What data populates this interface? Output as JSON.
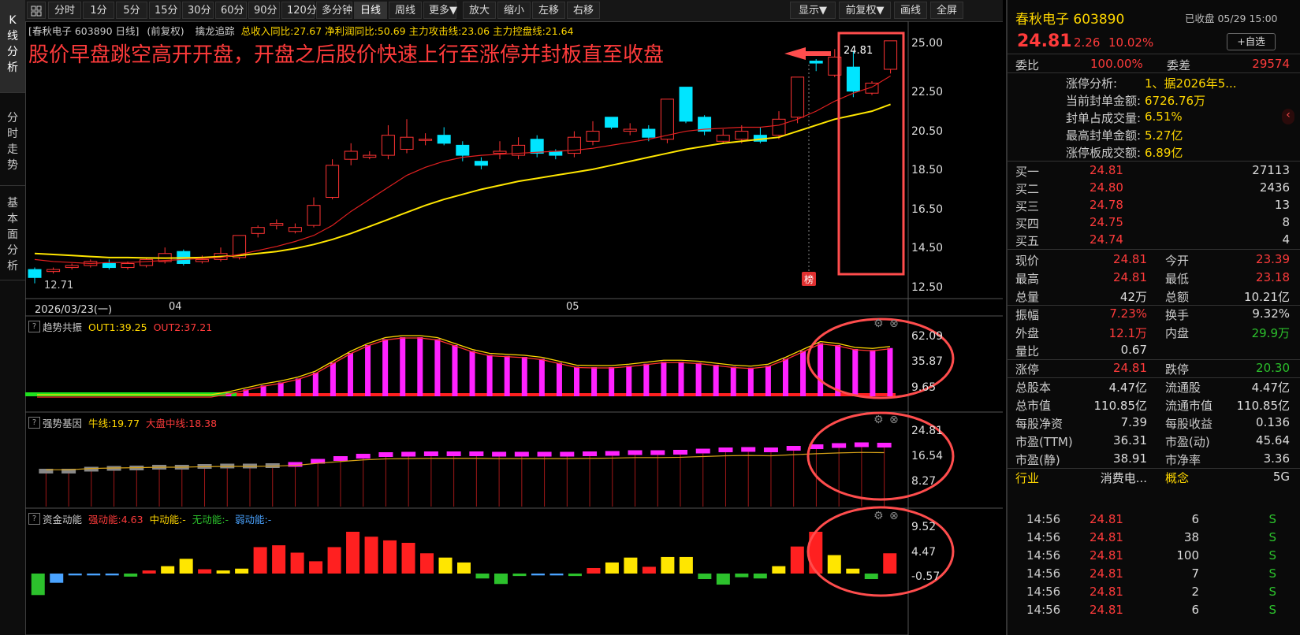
{
  "left_tabs": [
    "K线分析",
    "分时走势",
    "基本面分析"
  ],
  "toolbar": {
    "periods": [
      "分时",
      "1分",
      "5分",
      "15分",
      "30分",
      "60分",
      "90分",
      "120分",
      "多分钟",
      "日线",
      "周线",
      "更多▼"
    ],
    "tools": [
      "放大",
      "缩小",
      "左移",
      "右移"
    ],
    "right": [
      "显示▼",
      "前复权▼",
      "画线",
      "全屏"
    ],
    "active": "日线"
  },
  "chart": {
    "header": "[春秋电子 603890 日线]",
    "adjust": "(前复权)",
    "feature": "擒龙追踪",
    "metrics": "总收入同比:27.67 净利润同比:50.69 主力攻击线:23.06 主力控盘线:21.64",
    "annotation": "股价早盘跳空高开开盘，开盘之后股价快速上行至涨停并封板直至收盘",
    "price_axis": [
      "25.00",
      "22.50",
      "20.50",
      "18.50",
      "16.50",
      "14.50",
      "12.50"
    ],
    "date_labels": [
      "2026/03/23(一)",
      "04",
      "05"
    ],
    "low_label": "12.71",
    "high_label": "24.81",
    "bang_label": "榜",
    "up_color": "#ff3333",
    "down_color": "#00e5ff",
    "ma_short_color": "#e02020",
    "ma_long_color": "#ffe600"
  },
  "panels": [
    {
      "name": "趋势共振",
      "series": [
        {
          "name": "OUT1",
          "value": "39.25"
        },
        {
          "name": "OUT2",
          "value": "37.21"
        }
      ],
      "axis": [
        "62.09",
        "35.87",
        "9.65"
      ]
    },
    {
      "name": "强势基因",
      "series": [
        {
          "name": "牛线",
          "value": "19.77"
        },
        {
          "name": "大盘中线",
          "value": "18.38"
        }
      ],
      "axis": [
        "24.81",
        "16.54",
        "8.27"
      ]
    },
    {
      "name": "资金动能",
      "series": [
        {
          "name": "强动能",
          "value": "4.63"
        },
        {
          "name": "中动能",
          "value": "-"
        },
        {
          "name": "无动能",
          "value": "-"
        },
        {
          "name": "弱动能",
          "value": "-"
        }
      ],
      "axis": [
        "9.52",
        "4.47",
        "-0.57"
      ]
    }
  ],
  "candles": [
    [
      13.4,
      13.0,
      13.5,
      12.71
    ],
    [
      13.3,
      13.4,
      13.5,
      13.2
    ],
    [
      13.5,
      13.6,
      13.7,
      13.4
    ],
    [
      13.6,
      13.8,
      13.9,
      13.5
    ],
    [
      13.7,
      13.5,
      13.9,
      13.4
    ],
    [
      13.5,
      13.7,
      13.8,
      13.4
    ],
    [
      13.6,
      13.9,
      14.0,
      13.5
    ],
    [
      13.8,
      14.2,
      14.5,
      13.7
    ],
    [
      14.3,
      13.7,
      14.4,
      13.6
    ],
    [
      13.8,
      13.9,
      14.1,
      13.7
    ],
    [
      13.9,
      14.2,
      14.5,
      13.8
    ],
    [
      14.0,
      15.1,
      15.1,
      13.9
    ],
    [
      15.2,
      15.5,
      15.6,
      15.0
    ],
    [
      15.6,
      15.7,
      15.9,
      15.4
    ],
    [
      15.3,
      15.5,
      15.7,
      15.2
    ],
    [
      15.6,
      16.6,
      17.0,
      15.5
    ],
    [
      17.0,
      18.6,
      18.9,
      16.9
    ],
    [
      18.9,
      19.3,
      19.7,
      18.6
    ],
    [
      19.0,
      19.1,
      19.3,
      18.9
    ],
    [
      19.1,
      20.1,
      20.6,
      18.9
    ],
    [
      19.4,
      20.0,
      20.9,
      19.2
    ],
    [
      19.9,
      19.9,
      20.2,
      19.6
    ],
    [
      20.1,
      19.7,
      20.5,
      19.6
    ],
    [
      19.6,
      19.1,
      19.8,
      18.8
    ],
    [
      18.8,
      18.6,
      19.0,
      18.4
    ],
    [
      19.2,
      19.3,
      19.8,
      18.9
    ],
    [
      19.1,
      19.6,
      20.0,
      18.9
    ],
    [
      19.9,
      19.2,
      20.1,
      19.0
    ],
    [
      19.3,
      19.1,
      19.4,
      18.9
    ],
    [
      19.2,
      20.0,
      20.3,
      19.0
    ],
    [
      19.8,
      20.3,
      20.8,
      19.6
    ],
    [
      21.0,
      20.5,
      21.0,
      20.4
    ],
    [
      20.3,
      20.4,
      20.7,
      20.1
    ],
    [
      20.4,
      20.0,
      20.6,
      19.8
    ],
    [
      19.9,
      21.9,
      21.9,
      19.7
    ],
    [
      22.5,
      20.8,
      22.5,
      20.7
    ],
    [
      21.0,
      20.3,
      21.1,
      20.1
    ],
    [
      19.8,
      20.1,
      20.4,
      19.7
    ],
    [
      19.9,
      20.3,
      20.6,
      19.7
    ],
    [
      20.1,
      19.8,
      20.5,
      19.7
    ],
    [
      20.1,
      20.9,
      21.3,
      19.9
    ],
    [
      21.0,
      23.0,
      23.0,
      20.7
    ],
    [
      23.8,
      23.7,
      23.9,
      23.3
    ],
    [
      23.1,
      24.0,
      24.4,
      23.0
    ],
    [
      23.5,
      22.3,
      24.3,
      22.0
    ],
    [
      22.2,
      22.7,
      22.8,
      22.1
    ],
    [
      23.39,
      24.81,
      24.81,
      23.18
    ]
  ],
  "ma_short": [
    13.9,
    13.8,
    13.75,
    13.7,
    13.75,
    13.75,
    13.8,
    13.85,
    13.9,
    13.95,
    14.0,
    14.15,
    14.35,
    14.55,
    14.8,
    15.1,
    15.6,
    16.3,
    16.9,
    17.5,
    18.1,
    18.5,
    18.8,
    19.0,
    19.1,
    19.15,
    19.2,
    19.25,
    19.3,
    19.35,
    19.45,
    19.6,
    19.75,
    19.9,
    20.1,
    20.3,
    20.4,
    20.45,
    20.5,
    20.5,
    20.6,
    20.9,
    21.3,
    21.8,
    22.2,
    22.5,
    23.06
  ],
  "ma_long": [
    14.2,
    14.15,
    14.1,
    14.05,
    14.0,
    14.0,
    13.98,
    13.97,
    13.98,
    14.0,
    14.05,
    14.1,
    14.2,
    14.3,
    14.45,
    14.65,
    14.9,
    15.2,
    15.55,
    15.9,
    16.25,
    16.6,
    16.9,
    17.15,
    17.4,
    17.6,
    17.8,
    17.95,
    18.1,
    18.25,
    18.4,
    18.6,
    18.8,
    19.0,
    19.2,
    19.4,
    19.55,
    19.7,
    19.8,
    19.9,
    20.0,
    20.3,
    20.6,
    20.9,
    21.1,
    21.3,
    21.64
  ],
  "trend_bars": [
    0,
    0,
    0,
    0,
    0,
    0,
    0,
    0,
    0,
    0,
    0,
    1.5,
    3.5,
    5.5,
    7,
    9,
    12,
    17,
    22,
    26,
    29,
    30,
    30,
    29,
    26,
    23,
    21,
    20.5,
    20,
    19,
    17,
    15,
    14.8,
    14.8,
    15.5,
    16.5,
    17.5,
    17.5,
    17,
    16,
    15,
    14.5,
    15.5,
    19,
    23,
    27,
    26,
    24,
    23.5,
    24.5
  ],
  "gene_bars": [
    -1,
    -1,
    -0.5,
    -0.3,
    -0.2,
    0,
    0,
    0.2,
    0.3,
    0.3,
    0.4,
    0.7,
    1.5,
    2.2,
    2.8,
    3.2,
    3.3,
    3.4,
    3.4,
    3.4,
    3.3,
    3.3,
    3.3,
    3.3,
    3.4,
    3.5,
    3.7,
    3.7,
    3.8,
    4.1,
    4.4,
    4.5,
    4.4,
    4.8,
    5.2,
    5.5,
    5.7,
    5.6
  ],
  "fund_bars": [
    -3.5,
    -1.5,
    -0.3,
    -0.3,
    -0.3,
    -0.5,
    0.5,
    1.2,
    2.4,
    0.7,
    0.5,
    0.8,
    4.3,
    4.6,
    3.4,
    2.0,
    4.3,
    6.8,
    6.0,
    5.4,
    5.0,
    3.3,
    2.6,
    1.8,
    -0.8,
    -1.7,
    -0.4,
    -0.3,
    -0.3,
    -0.4,
    0.9,
    1.8,
    2.6,
    1.1,
    2.7,
    2.7,
    -0.9,
    -1.8,
    -0.6,
    -0.8,
    1.2,
    4.4,
    6.8,
    3.0,
    0.8,
    -0.9,
    3.3
  ],
  "quote": {
    "name": "春秋电子 603890",
    "status": "已收盘 05/29 15:00",
    "price": "24.81",
    "change": "2.26",
    "change_pct": "10.02%",
    "add_btn": "+自选",
    "weibi_label": "委比",
    "weibi": "100.00%",
    "weicha_label": "委差",
    "weicha": "29574",
    "zt_lines": [
      {
        "label": "涨停分析:",
        "value": "1、据2026年5..."
      },
      {
        "label": "当前封单金额:",
        "value": "6726.76万"
      },
      {
        "label": "封单占成交量:",
        "value": "6.51%"
      },
      {
        "label": "最高封单金额:",
        "value": "5.27亿"
      },
      {
        "label": "涨停板成交额:",
        "value": "6.89亿"
      }
    ],
    "bids": [
      {
        "label": "买一",
        "price": "24.81",
        "vol": "27113"
      },
      {
        "label": "买二",
        "price": "24.80",
        "vol": "2436"
      },
      {
        "label": "买三",
        "price": "24.78",
        "vol": "13"
      },
      {
        "label": "买四",
        "price": "24.75",
        "vol": "8"
      },
      {
        "label": "买五",
        "price": "24.74",
        "vol": "4"
      }
    ],
    "stats": [
      {
        "l1": "现价",
        "v1": "24.81",
        "c1": "red",
        "l2": "今开",
        "v2": "23.39",
        "c2": "red"
      },
      {
        "l1": "最高",
        "v1": "24.81",
        "c1": "red",
        "l2": "最低",
        "v2": "23.18",
        "c2": "red"
      },
      {
        "l1": "总量",
        "v1": "42万",
        "c1": "white",
        "l2": "总额",
        "v2": "10.21亿",
        "c2": "white"
      },
      {
        "l1": "振幅",
        "v1": "7.23%",
        "c1": "red",
        "l2": "换手",
        "v2": "9.32%",
        "c2": "white"
      },
      {
        "l1": "外盘",
        "v1": "12.1万",
        "c1": "red",
        "l2": "内盘",
        "v2": "29.9万",
        "c2": "green"
      },
      {
        "l1": "量比",
        "v1": "0.67",
        "c1": "white",
        "l2": "",
        "v2": "",
        "c2": "white"
      },
      {
        "l1": "涨停",
        "v1": "24.81",
        "c1": "red",
        "l2": "跌停",
        "v2": "20.30",
        "c2": "green"
      },
      {
        "l1": "总股本",
        "v1": "4.47亿",
        "c1": "white",
        "l2": "流通股",
        "v2": "4.47亿",
        "c2": "white"
      },
      {
        "l1": "总市值",
        "v1": "110.85亿",
        "c1": "white",
        "l2": "流通市值",
        "v2": "110.85亿",
        "c2": "white"
      },
      {
        "l1": "每股净资",
        "v1": "7.39",
        "c1": "white",
        "l2": "每股收益",
        "v2": "0.136",
        "c2": "white"
      },
      {
        "l1": "市盈(TTM)",
        "v1": "36.31",
        "c1": "white",
        "l2": "市盈(动)",
        "v2": "45.64",
        "c2": "white"
      },
      {
        "l1": "市盈(静)",
        "v1": "38.91",
        "c1": "white",
        "l2": "市净率",
        "v2": "3.36",
        "c2": "white"
      },
      {
        "l1": "行业",
        "v1": "消费电...",
        "c1": "white",
        "l2": "概念",
        "v2": "5G",
        "c2": "white"
      }
    ],
    "ticks": [
      {
        "time": "14:56",
        "price": "24.81",
        "vol": "6",
        "side": "S"
      },
      {
        "time": "14:56",
        "price": "24.81",
        "vol": "38",
        "side": "S"
      },
      {
        "time": "14:56",
        "price": "24.81",
        "vol": "100",
        "side": "S"
      },
      {
        "time": "14:56",
        "price": "24.81",
        "vol": "7",
        "side": "S"
      },
      {
        "time": "14:56",
        "price": "24.81",
        "vol": "2",
        "side": "S"
      },
      {
        "time": "14:56",
        "price": "24.81",
        "vol": "6",
        "side": "S"
      }
    ]
  }
}
